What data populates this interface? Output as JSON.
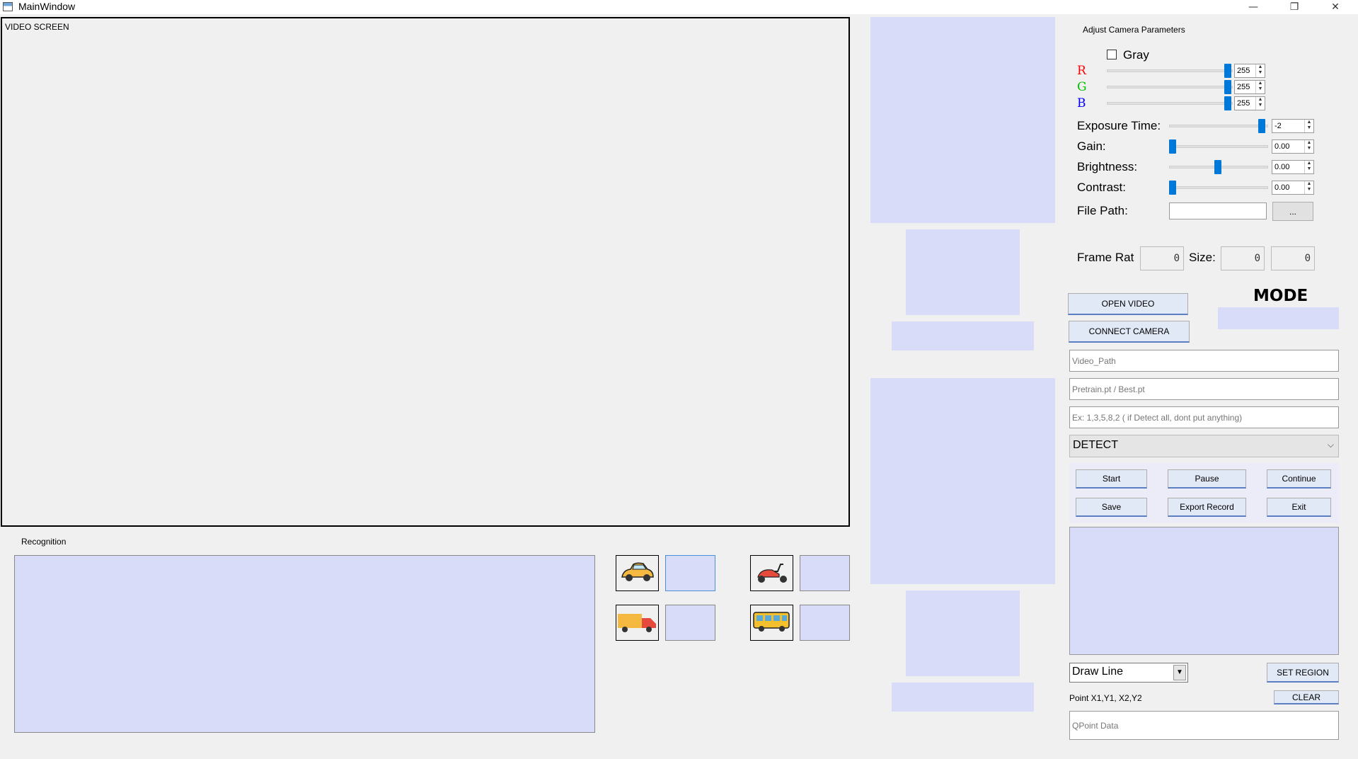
{
  "window": {
    "title": "MainWindow",
    "minimize": "—",
    "restore": "❐",
    "close": "✕"
  },
  "video": {
    "label": "VIDEO SCREEN"
  },
  "recognition": {
    "label": "Recognition"
  },
  "camera_params": {
    "heading": "Adjust Camera Parameters",
    "gray_label": "Gray",
    "gray_checked": false,
    "r_label": "R",
    "g_label": "G",
    "b_label": "B",
    "r_value": "255",
    "g_value": "255",
    "b_value": "255",
    "r_level": 1.0,
    "g_level": 1.0,
    "b_level": 1.0,
    "exposure_label": "Exposure Time:",
    "exposure_value": "-2",
    "exposure_level": 0.95,
    "gain_label": "Gain:",
    "gain_value": "0.00",
    "gain_level": 0.0,
    "brightness_label": "Brightness:",
    "brightness_value": "0.00",
    "brightness_level": 0.5,
    "contrast_label": "Contrast:",
    "contrast_value": "0.00",
    "contrast_level": 0.0,
    "filepath_label": "File Path:",
    "filepath_value": "",
    "browse_label": "...",
    "framerate_label": "Frame Rat",
    "size_label": "Size:",
    "framerate_value": "0",
    "size_w_value": "0",
    "size_h_value": "0"
  },
  "mode": {
    "label": "MODE"
  },
  "buttons": {
    "open_video": "OPEN VIDEO",
    "connect_camera": "CONNECT CAMERA",
    "start": "Start",
    "pause": "Pause",
    "continue": "Continue",
    "save": "Save",
    "export_record": "Export Record",
    "exit": "Exit",
    "set_region": "SET REGION",
    "clear": "CLEAR"
  },
  "inputs": {
    "video_path_placeholder": "Video_Path",
    "model_placeholder": "Pretrain.pt / Best.pt",
    "classes_placeholder": "Ex: 1,3,5,8,2   ( if Detect all, dont put anything)",
    "qpoint_placeholder": "QPoint Data"
  },
  "detect_select": {
    "value": "DETECT"
  },
  "draw_select": {
    "value": "Draw Line"
  },
  "point_label": "Point X1,Y1, X2,Y2",
  "vehicle_icons": [
    "car-icon",
    "scooter-icon",
    "truck-icon",
    "bus-icon"
  ],
  "colors": {
    "panel": "#d8dcf9",
    "accent": "#0078d7",
    "r": "#ff0000",
    "g": "#00c000",
    "b": "#0000ff"
  }
}
